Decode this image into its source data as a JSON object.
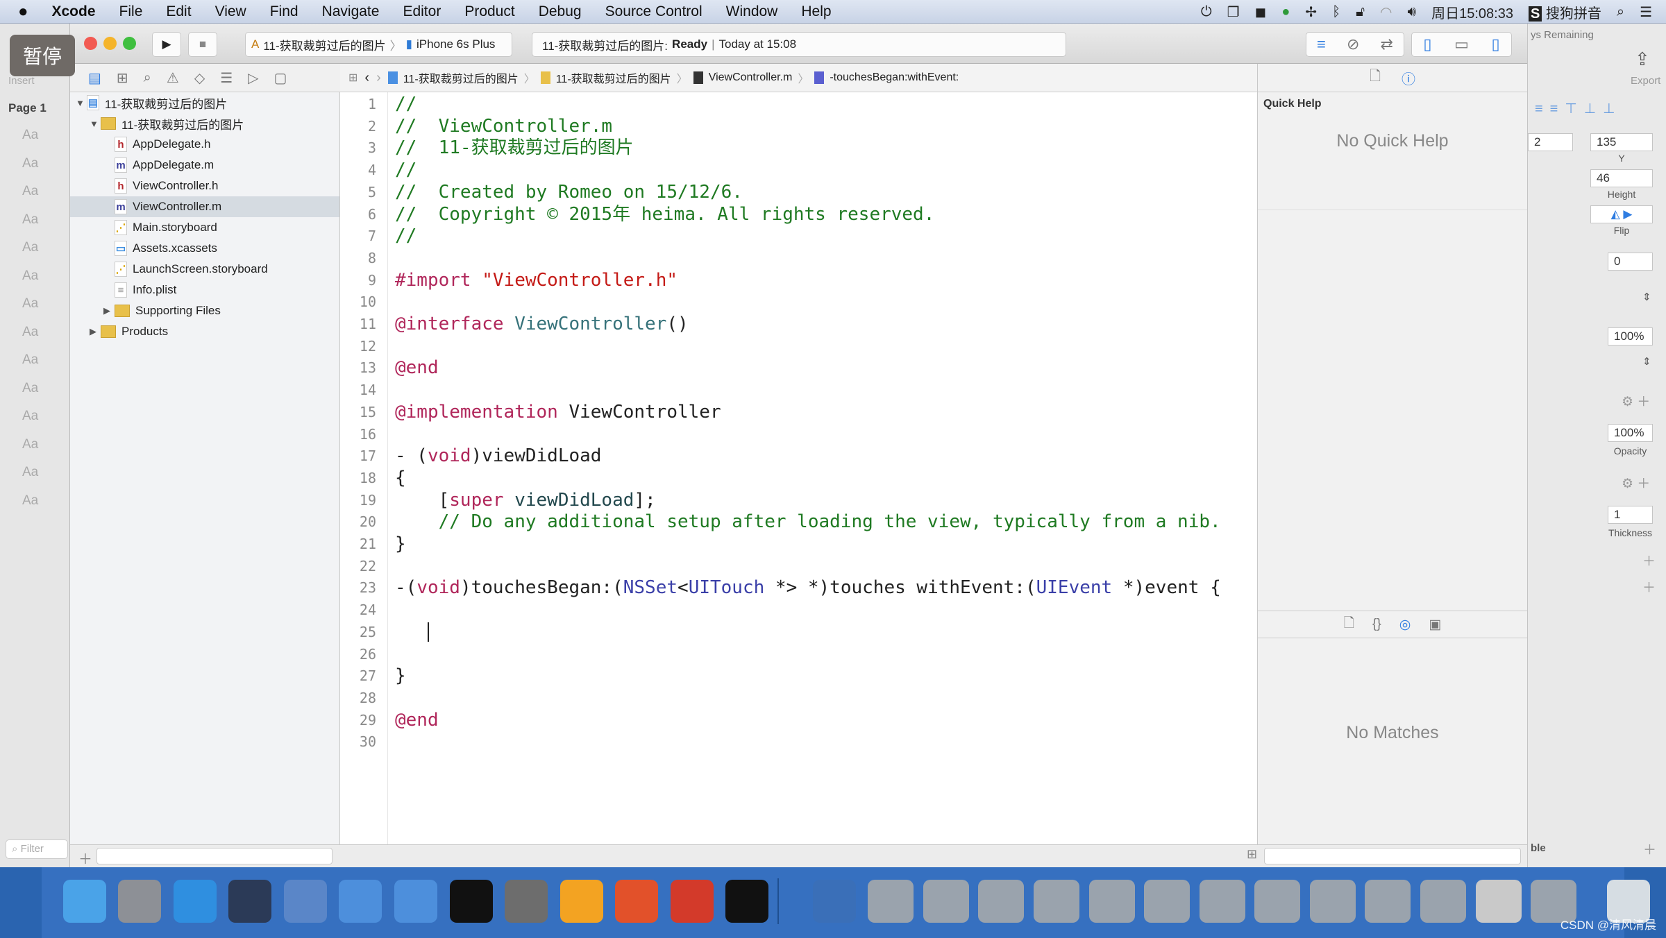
{
  "menubar": {
    "apple": "",
    "items": [
      "Xcode",
      "File",
      "Edit",
      "View",
      "Find",
      "Navigate",
      "Editor",
      "Product",
      "Debug",
      "Source Control",
      "Window",
      "Help"
    ],
    "clock": "周日15:08:33",
    "input_method": "搜狗拼音"
  },
  "overlay": {
    "pause_label": "暂停"
  },
  "left_strip": {
    "insert": "Insert",
    "page": "Page 1",
    "aa": "Aa",
    "filter": "Filter"
  },
  "toolbar": {
    "scheme": "11-获取裁剪过后的图片",
    "device": "iPhone 6s Plus",
    "status_project": "11-获取裁剪过后的图片:",
    "status_state": "Ready",
    "status_time": "Today at 15:08"
  },
  "jumpbar": {
    "items": [
      "11-获取裁剪过后的图片",
      "11-获取裁剪过后的图片",
      "ViewController.m",
      "-touchesBegan:withEvent:"
    ]
  },
  "navigator": {
    "items": [
      {
        "label": "11-获取裁剪过后的图片",
        "type": "project",
        "level": 0,
        "open": true
      },
      {
        "label": "11-获取裁剪过后的图片",
        "type": "folder",
        "level": 1,
        "open": true
      },
      {
        "label": "AppDelegate.h",
        "type": "h",
        "level": 2
      },
      {
        "label": "AppDelegate.m",
        "type": "m",
        "level": 2
      },
      {
        "label": "ViewController.h",
        "type": "h",
        "level": 2
      },
      {
        "label": "ViewController.m",
        "type": "m",
        "level": 2,
        "selected": true
      },
      {
        "label": "Main.storyboard",
        "type": "storyboard",
        "level": 2
      },
      {
        "label": "Assets.xcassets",
        "type": "assets",
        "level": 2
      },
      {
        "label": "LaunchScreen.storyboard",
        "type": "storyboard",
        "level": 2
      },
      {
        "label": "Info.plist",
        "type": "plist",
        "level": 2
      },
      {
        "label": "Supporting Files",
        "type": "folder",
        "level": 2,
        "open": false
      },
      {
        "label": "Products",
        "type": "folder",
        "level": 1,
        "open": false
      }
    ]
  },
  "editor": {
    "lines": [
      [
        [
          "c",
          "//"
        ]
      ],
      [
        [
          "c",
          "//  ViewController.m"
        ]
      ],
      [
        [
          "c",
          "//  11-获取裁剪过后的图片"
        ]
      ],
      [
        [
          "c",
          "//"
        ]
      ],
      [
        [
          "c",
          "//  Created by Romeo on 15/12/6."
        ]
      ],
      [
        [
          "c",
          "//  Copyright © 2015年 heima. All rights reserved."
        ]
      ],
      [
        [
          "c",
          "//"
        ]
      ],
      [],
      [
        [
          "k",
          "#import "
        ],
        [
          "s",
          "\"ViewController.h\""
        ]
      ],
      [],
      [
        [
          "k",
          "@interface "
        ],
        [
          "t",
          "ViewController"
        ],
        [
          "",
          "()"
        ]
      ],
      [],
      [
        [
          "k",
          "@end"
        ]
      ],
      [],
      [
        [
          "k",
          "@implementation "
        ],
        [
          "",
          "ViewController"
        ]
      ],
      [],
      [
        [
          "",
          "- ("
        ],
        [
          "k",
          "void"
        ],
        [
          "",
          ")viewDidLoad"
        ]
      ],
      [
        [
          "",
          "{"
        ]
      ],
      [
        [
          "",
          "    ["
        ],
        [
          "k",
          "super "
        ],
        [
          "f",
          "viewDidLoad"
        ],
        [
          "",
          "];"
        ]
      ],
      [
        [
          "c",
          "    // Do any additional setup after loading the view, typically from a nib."
        ]
      ],
      [
        [
          "",
          "}"
        ]
      ],
      [],
      [
        [
          "",
          "-("
        ],
        [
          "k",
          "void"
        ],
        [
          "",
          ")touchesBegan:("
        ],
        [
          "p",
          "NSSet"
        ],
        [
          "",
          "<"
        ],
        [
          "p",
          "UITouch"
        ],
        [
          "",
          " *> *)touches withEvent:("
        ],
        [
          "p",
          "UIEvent"
        ],
        [
          "",
          " *)event {"
        ]
      ],
      [],
      [
        [
          "caret",
          ""
        ]
      ],
      [],
      [
        [
          "",
          "}"
        ]
      ],
      [],
      [
        [
          "k",
          "@end"
        ]
      ],
      []
    ]
  },
  "utilities": {
    "quick_help_title": "Quick Help",
    "no_quick_help": "No Quick Help",
    "no_matches": "No Matches"
  },
  "inspector": {
    "remaining": "ys Remaining",
    "export": "Export",
    "x_value": "2",
    "y_value": "135",
    "y_label": "Y",
    "height_value": "46",
    "height_label": "Height",
    "flip_label": "Flip",
    "rotation": "0",
    "fill_opacity": "100%",
    "opacity": "100%",
    "opacity_label": "Opacity",
    "thickness": "1",
    "thickness_label": "Thickness",
    "table_label": "ble"
  },
  "dock": {
    "apps": [
      "finder",
      "launchpad",
      "safari",
      "mouse",
      "keynote",
      "xcode",
      "instruments",
      "terminal",
      "system-preferences",
      "sketch",
      "powerpoint",
      "parallels",
      "console",
      "quicktime",
      "window",
      "window",
      "window",
      "window",
      "window",
      "window",
      "window",
      "window",
      "window",
      "window",
      "window",
      "preview",
      "window",
      "trash"
    ],
    "colors": {
      "finder": "#4aa3e8",
      "launchpad": "#8d9096",
      "safari": "#2f8fe0",
      "mouse": "#2b3a57",
      "keynote": "#5a86c8",
      "xcode": "#4d8fdc",
      "instruments": "#4d8fdc",
      "terminal": "#111111",
      "system-preferences": "#6d6d6d",
      "sketch": "#f3a322",
      "powerpoint": "#e2512a",
      "parallels": "#d33a2a",
      "console": "#111111",
      "quicktime": "#3a6fb8",
      "window": "#9aa3ad",
      "preview": "#c9c9c9",
      "trash": "#d6dde3"
    }
  },
  "watermark": "CSDN @清风清晨",
  "colors": {
    "accent": "#2f7de1",
    "comment": "#1f7a22",
    "keyword": "#b0265a",
    "string": "#c41a16",
    "selection": "#d5dbe1"
  }
}
